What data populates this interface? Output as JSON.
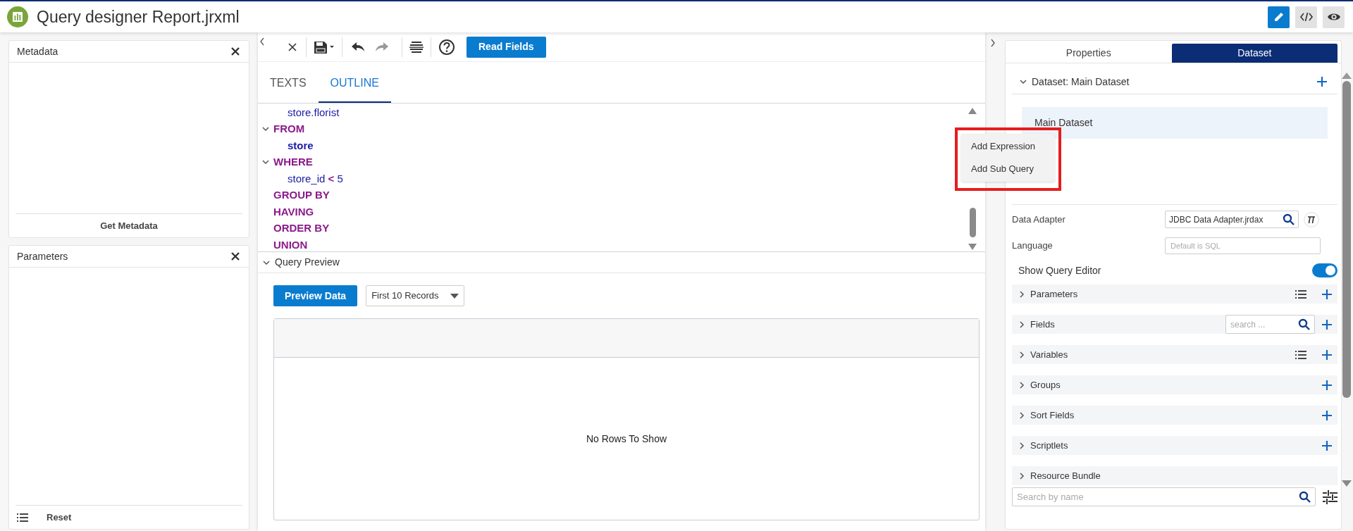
{
  "header": {
    "title": "Query designer Report.jrxml",
    "view_buttons": [
      {
        "kind": "edit",
        "selected": true
      },
      {
        "kind": "code",
        "selected": false
      },
      {
        "kind": "preview",
        "selected": false
      }
    ]
  },
  "left_panels": [
    {
      "title": "Metadata",
      "footer": {
        "kind": "button",
        "label": "Get Metadata"
      }
    },
    {
      "title": "Parameters",
      "footer": {
        "kind": "list",
        "label": "Reset"
      }
    }
  ],
  "toolbar": {
    "button": "Read Fields"
  },
  "editor_tabs": [
    {
      "label": "TEXTS",
      "selected": false
    },
    {
      "label": "OUTLINE",
      "selected": true
    }
  ],
  "outline": [
    {
      "kind": "field",
      "text": "store.florist"
    },
    {
      "kind": "clause",
      "text": "FROM",
      "expanded": true,
      "children": [
        {
          "kind": "table",
          "text": "store"
        }
      ]
    },
    {
      "kind": "clause",
      "text": "WHERE",
      "expanded": true,
      "children": [
        {
          "kind": "condition",
          "text": "store_id",
          "operator": "<",
          "value": "5"
        }
      ]
    },
    {
      "kind": "clause",
      "text": "GROUP BY"
    },
    {
      "kind": "clause",
      "text": "HAVING"
    },
    {
      "kind": "clause",
      "text": "ORDER BY"
    },
    {
      "kind": "clause",
      "text": "UNION"
    }
  ],
  "context_menu": {
    "highlighted": true,
    "items": [
      "Add Expression",
      "Add Sub Query"
    ]
  },
  "query_preview": {
    "title": "Query Preview",
    "expanded": true,
    "button": "Preview Data",
    "limit": "First 10 Records",
    "empty_message": "No Rows To Show"
  },
  "right_tabs": [
    {
      "label": "Properties",
      "selected": false
    },
    {
      "label": "Dataset",
      "selected": true
    }
  ],
  "dataset": {
    "title": "Dataset: Main Dataset",
    "expanded": true,
    "items": [
      {
        "label": "Main Dataset",
        "selected": true
      }
    ]
  },
  "data_adapter": {
    "label": "Data Adapter",
    "value": "JDBC Data Adapter.jrdax"
  },
  "language": {
    "label": "Language",
    "placeholder": "Default is SQL"
  },
  "show_query_editor": {
    "label": "Show Query Editor",
    "on": true
  },
  "sections": [
    {
      "label": "Parameters",
      "kind": "list",
      "expanded": false
    },
    {
      "label": "Fields",
      "kind": "search",
      "placeholder": "search ...",
      "expanded": false
    },
    {
      "label": "Variables",
      "kind": "list",
      "expanded": false
    },
    {
      "label": "Groups",
      "kind": "plain",
      "expanded": false
    },
    {
      "label": "Sort Fields",
      "kind": "plain",
      "expanded": false
    },
    {
      "label": "Scriptlets",
      "kind": "plain",
      "expanded": false
    },
    {
      "label": "Resource Bundle",
      "kind": "bare",
      "expanded": false
    }
  ],
  "search": {
    "placeholder": "Search by name"
  }
}
